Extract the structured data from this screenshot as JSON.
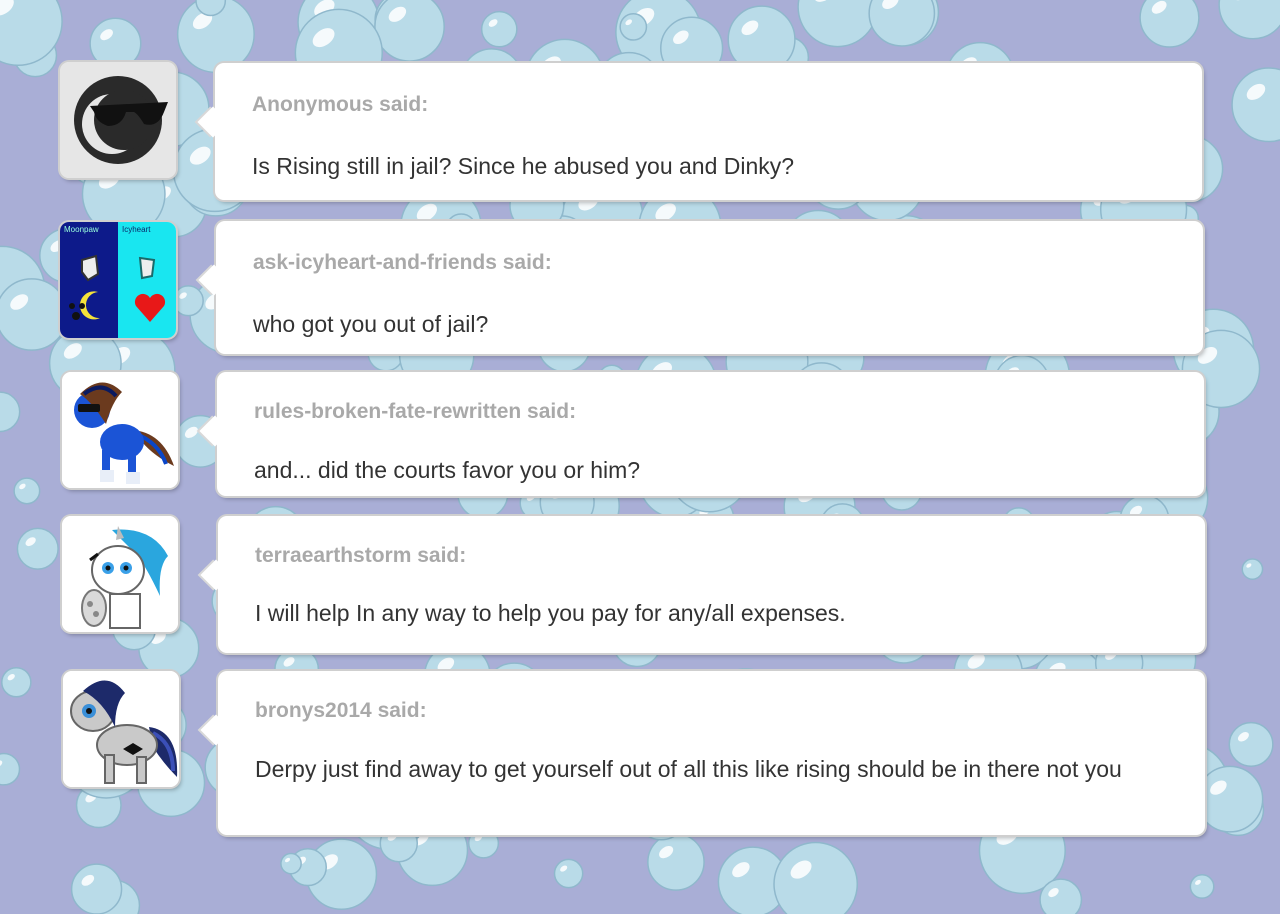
{
  "questions": [
    {
      "asker_line": "Anonymous said:",
      "question": "Is Rising still in jail? Since he abused you and Dinky?",
      "avatar_icon": "anonymous-sunglasses-moon-icon"
    },
    {
      "asker_line": "ask-icyheart-and-friends said:",
      "question": "who got you out of jail?",
      "avatar_icon": "icyheart-split-avatar-icon",
      "avatar_caption_left": "Moonpaw",
      "avatar_caption_right": "Icyheart"
    },
    {
      "asker_line": "rules-broken-fate-rewritten said:",
      "question": "and... did the courts favor you or him?",
      "avatar_icon": "blue-pony-avatar-icon"
    },
    {
      "asker_line": "terraearthstorm said:",
      "question": "I will help In any way to help you pay for any/all expenses.",
      "avatar_icon": "white-unicorn-avatar-icon"
    },
    {
      "asker_line": "bronys2014 said:",
      "question": "Derpy just find away to get yourself out of all this like rising should be in there not you",
      "avatar_icon": "grey-pony-bowtie-avatar-icon"
    }
  ],
  "colors": {
    "background": "#a9aed6",
    "bubble": "#b9dbe8",
    "asker_text": "#a9a9a9",
    "question_text": "#333333"
  }
}
